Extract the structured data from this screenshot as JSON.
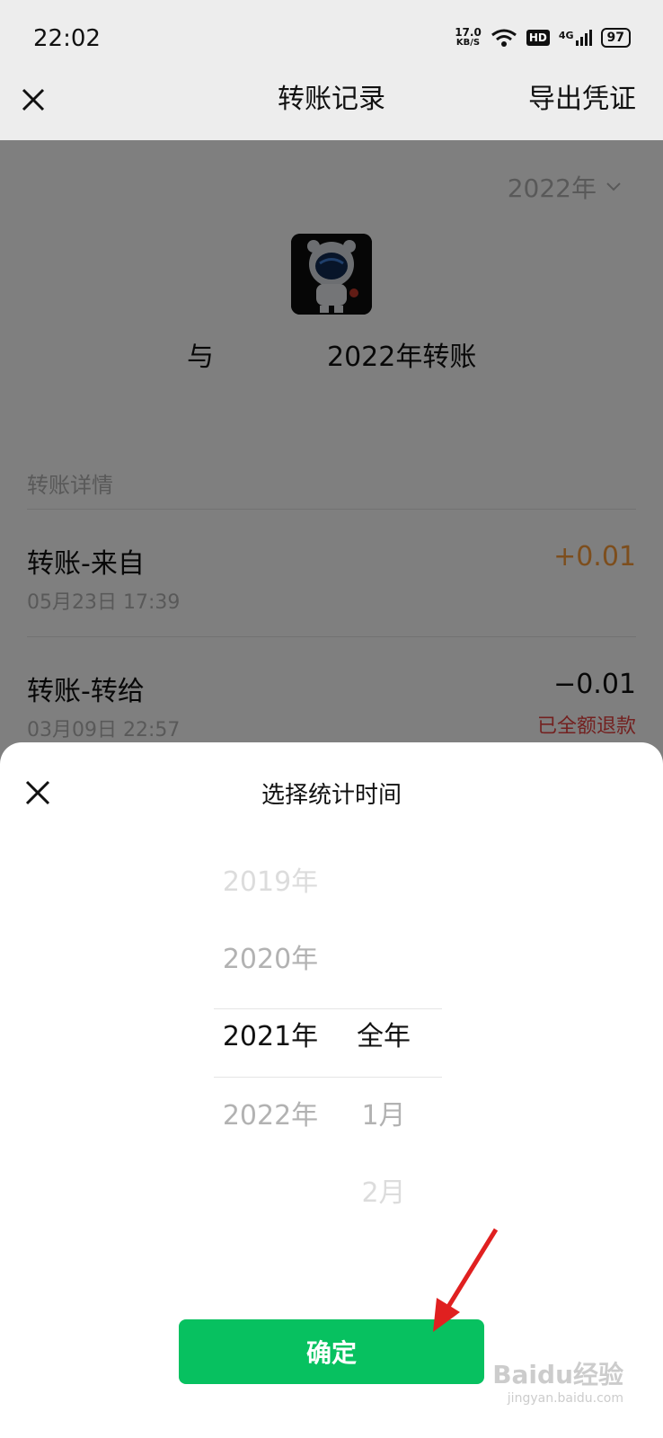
{
  "status_bar": {
    "time": "22:02",
    "net_speed_value": "17.0",
    "net_speed_unit": "KB/S",
    "hd": "HD",
    "network": "4G",
    "battery": "97"
  },
  "nav": {
    "title": "转账记录",
    "export_label": "导出凭证"
  },
  "content": {
    "year_select": "2022年",
    "headline_with": "与",
    "headline_text": "2022年转账",
    "section_title": "转账详情",
    "records": [
      {
        "title": "转账-来自",
        "time": "05月23日 17:39",
        "amount": "+0.01",
        "amount_color": "#fa9d3b",
        "status": ""
      },
      {
        "title": "转账-转给",
        "time": "03月09日 22:57",
        "amount": "−0.01",
        "amount_color": "#111111",
        "status": "已全额退款"
      }
    ]
  },
  "sheet": {
    "title": "选择统计时间",
    "years": [
      "2019年",
      "2020年",
      "2021年",
      "2022年"
    ],
    "selected_year": "2021年",
    "periods": [
      "全年",
      "1月",
      "2月"
    ],
    "selected_period": "全年",
    "confirm_label": "确定"
  },
  "watermark": {
    "brand": "Baidu经验",
    "url": "jingyan.baidu.com"
  },
  "colors": {
    "accent": "#07c160",
    "income": "#fa9d3b",
    "refund": "#e64340"
  }
}
